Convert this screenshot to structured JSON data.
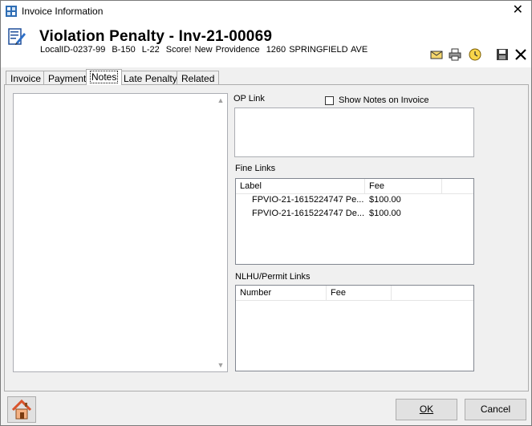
{
  "window": {
    "title": "Invoice Information"
  },
  "header": {
    "heading": "Violation Penalty - Inv-21-00069",
    "local_id": "LocalID-0237-99",
    "block": "B-150",
    "lot": "L-22",
    "owner": "Score! New Providence",
    "address": "1260 SPRINGFIELD AVE"
  },
  "toolbar": {
    "icons": [
      "envelope-icon",
      "printer-icon",
      "clock-icon",
      "save-icon",
      "close-icon"
    ]
  },
  "tabs": [
    {
      "label": "Invoice",
      "active": false
    },
    {
      "label": "Payment",
      "active": false
    },
    {
      "label": "Notes",
      "active": true
    },
    {
      "label": "Late Penalty",
      "active": false
    },
    {
      "label": "Related",
      "active": false
    }
  ],
  "notes": {
    "op_link_label": "OP Link",
    "show_notes_label": "Show Notes on Invoice",
    "show_notes_checked": false,
    "fine_links_label": "Fine Links",
    "fine_links": {
      "columns": [
        "Label",
        "Fee"
      ],
      "rows": [
        {
          "label": "FPVIO-21-1615224747 Pe...",
          "fee": "$100.00"
        },
        {
          "label": "FPVIO-21-1615224747 De...",
          "fee": "$100.00"
        }
      ]
    },
    "nlhu_label": "NLHU/Permit Links",
    "nlhu_links": {
      "columns": [
        "Number",
        "Fee"
      ],
      "rows": []
    }
  },
  "footer": {
    "ok_label": "OK",
    "cancel_label": "Cancel"
  }
}
